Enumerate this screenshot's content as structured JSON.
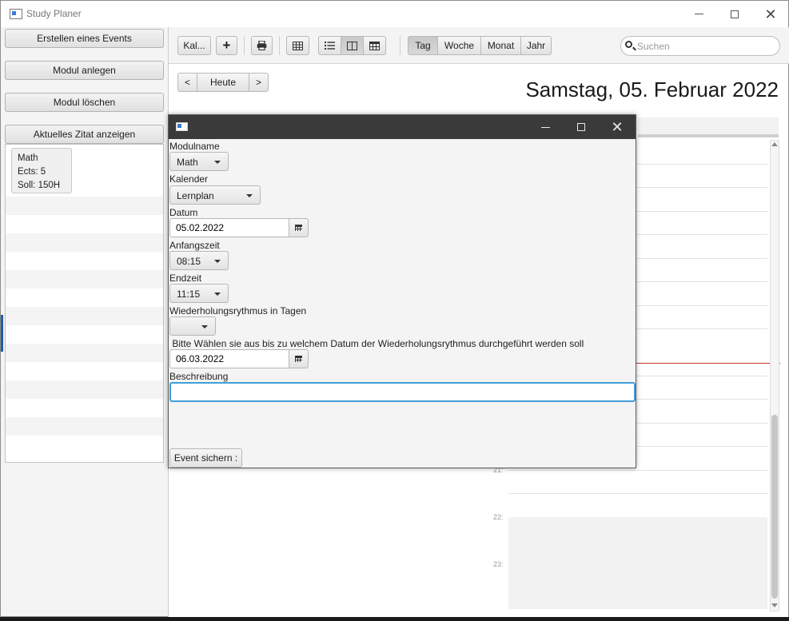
{
  "window": {
    "title": "Study Planer"
  },
  "sidebar": {
    "buttons": [
      "Erstellen eines Events",
      "Modul anlegen",
      "Modul löschen",
      "Aktuelles Zitat anzeigen"
    ],
    "module_card": {
      "name": "Math",
      "ects": "Ects: 5",
      "soll": "Soll: 150H"
    }
  },
  "toolbar": {
    "calendars_label": "Kal...",
    "add_symbol": "+",
    "views": [
      "Tag",
      "Woche",
      "Monat",
      "Jahr"
    ],
    "selected_view": "Tag",
    "search_placeholder": "Suchen"
  },
  "navigation": {
    "prev": "<",
    "today": "Heute",
    "next": ">"
  },
  "date_title": "Samstag, 05. Februar 2022",
  "hour_labels": [
    "21:",
    "22:",
    "23:"
  ],
  "dialog": {
    "fields": {
      "modulname_label": "Modulname",
      "modulname_value": "Math",
      "kalender_label": "Kalender",
      "kalender_value": "Lernplan",
      "datum_label": "Datum",
      "datum_value": "05.02.2022",
      "anfangszeit_label": "Anfangszeit",
      "anfangszeit_value": "08:15",
      "endzeit_label": "Endzeit",
      "endzeit_value": "11:15",
      "wiederholung_label": "Wiederholungsrythmus in Tagen",
      "wiederholung_value": "",
      "enddatum_label": " Bitte Wählen sie aus bis zu welchem Datum der Wiederholungsrythmus durchgeführt werden soll",
      "enddatum_value": "06.03.2022",
      "beschreibung_label": "Beschreibung",
      "beschreibung_value": ""
    },
    "save_label": "Event sichern :"
  },
  "colors": {
    "accent_focus": "#3f9fd9",
    "dialog_titlebar": "#3a3a3a",
    "current_time_line": "#c0392b"
  }
}
